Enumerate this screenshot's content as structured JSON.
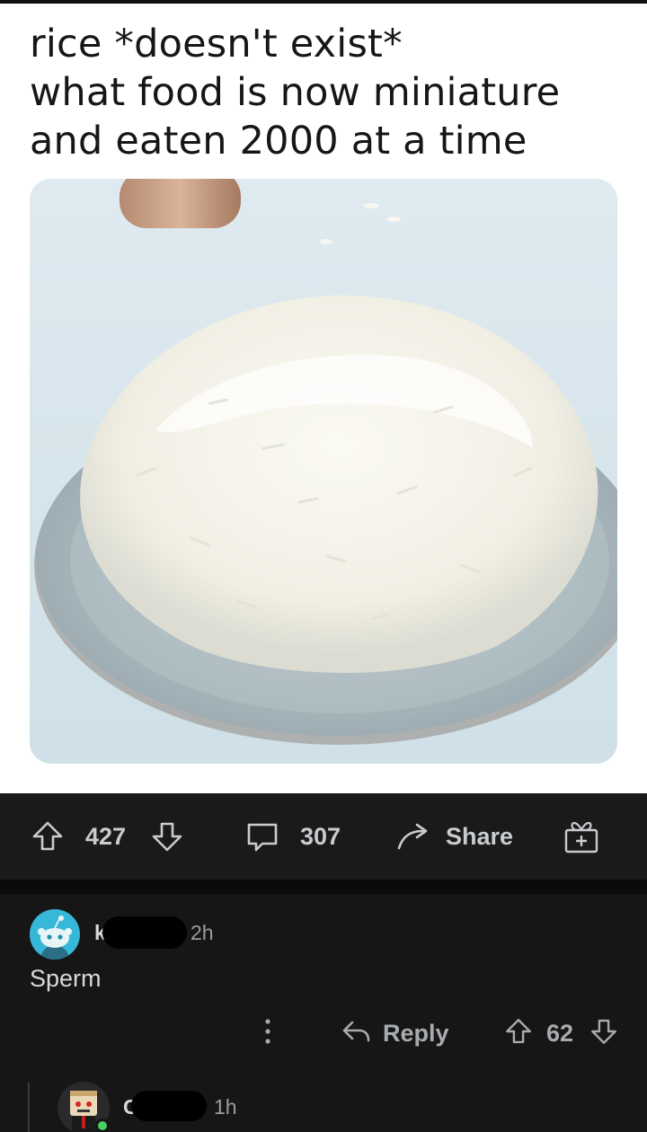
{
  "meme": {
    "caption_line1": "rice *doesn't exist*",
    "caption_line2": "what food is now miniature",
    "caption_line3": "and eaten 2000 at a time"
  },
  "post_actions": {
    "upvote_icon": "upvote-arrow-icon",
    "score": "427",
    "downvote_icon": "downvote-arrow-icon",
    "comment_icon": "comment-bubble-icon",
    "comment_count": "307",
    "share_icon": "share-arrow-icon",
    "share_label": "Share",
    "award_icon": "gift-award-icon"
  },
  "comments": [
    {
      "avatar_icon": "snoo-avatar-icon",
      "username_visible": "k",
      "time": "2h",
      "body": "Sperm",
      "more_icon": "more-options-icon",
      "reply_label": "Reply",
      "score": "62"
    },
    {
      "avatar_icon": "custom-avatar-icon",
      "username_visible": "C",
      "time": "1h"
    }
  ],
  "colors": {
    "page_bg": "#0e0e0e",
    "action_bar_bg": "#1a1a1b",
    "comment_bg": "#161617",
    "snoo_avatar_bg": "#36b8d8",
    "online": "#46d160"
  }
}
